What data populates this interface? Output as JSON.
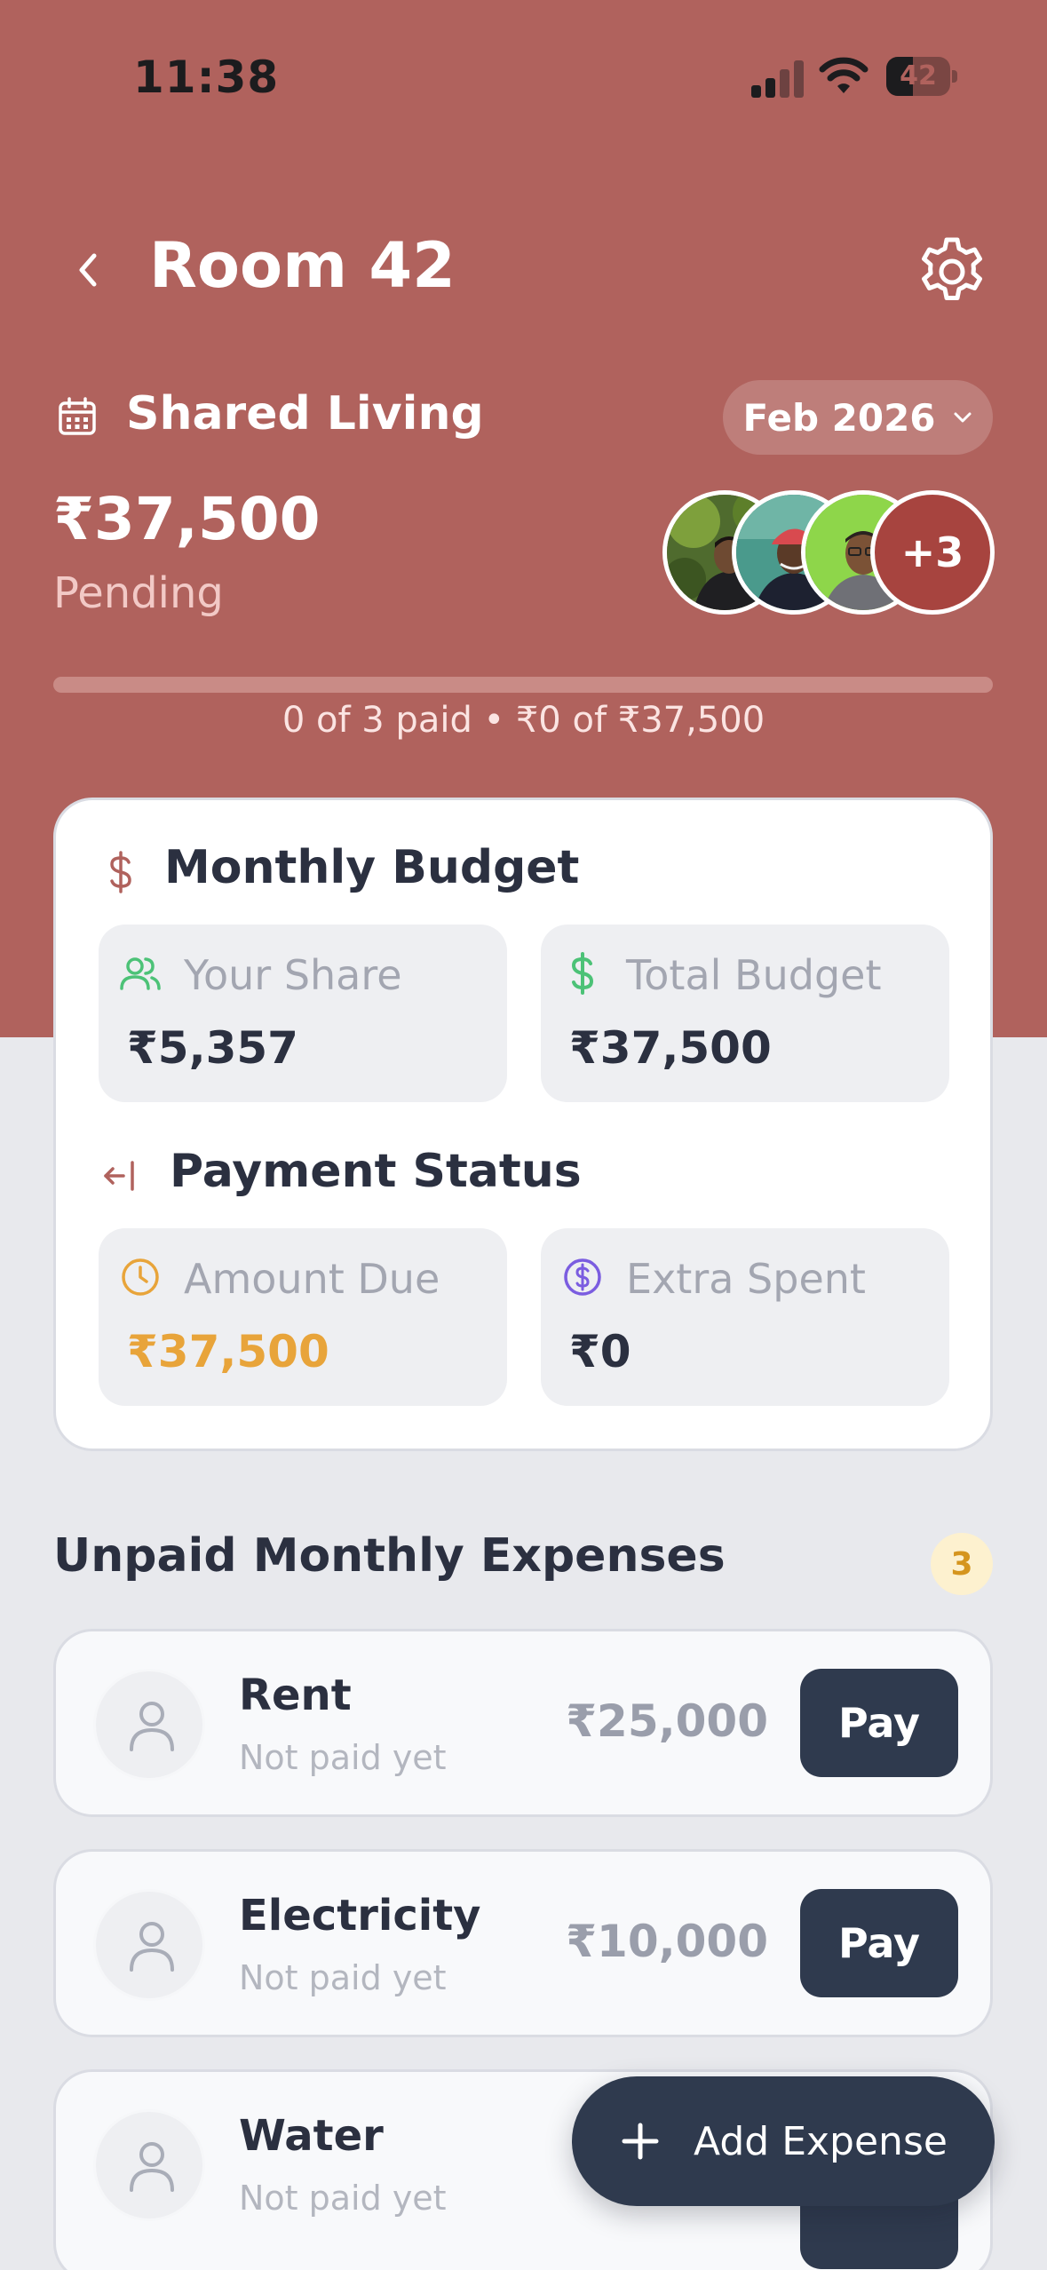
{
  "status_bar": {
    "time": "11:38",
    "battery": "42",
    "battery_level": 0.42
  },
  "header": {
    "title": "Room 42",
    "subtitle": "Shared Living",
    "month_selector": "Feb 2026"
  },
  "summary": {
    "amount": "₹37,500",
    "status": "Pending",
    "members_more": "+3",
    "progress_text": "0 of 3 paid • ₹0 of ₹37,500",
    "progress_fraction": 0
  },
  "budget_card": {
    "monthly_budget_title": "Monthly Budget",
    "your_share_label": "Your Share",
    "your_share_value": "₹5,357",
    "total_budget_label": "Total Budget",
    "total_budget_value": "₹37,500",
    "payment_status_title": "Payment Status",
    "amount_due_label": "Amount Due",
    "amount_due_value": "₹37,500",
    "extra_spent_label": "Extra Spent",
    "extra_spent_value": "₹0"
  },
  "expenses": {
    "title": "Unpaid Monthly Expenses",
    "count": "3",
    "items": [
      {
        "name": "Rent",
        "status": "Not paid yet",
        "amount": "₹25,000",
        "action": "Pay"
      },
      {
        "name": "Electricity",
        "status": "Not paid yet",
        "amount": "₹10,000",
        "action": "Pay"
      },
      {
        "name": "Water",
        "status": "Not paid yet",
        "amount": "",
        "action": ""
      }
    ]
  },
  "fab": {
    "label": "Add Expense"
  },
  "colors": {
    "hero": "#b0625d",
    "dark_button": "#2f3a4e",
    "amount_due": "#e8a43a",
    "green": "#4cc277",
    "purple": "#7b5de0"
  }
}
